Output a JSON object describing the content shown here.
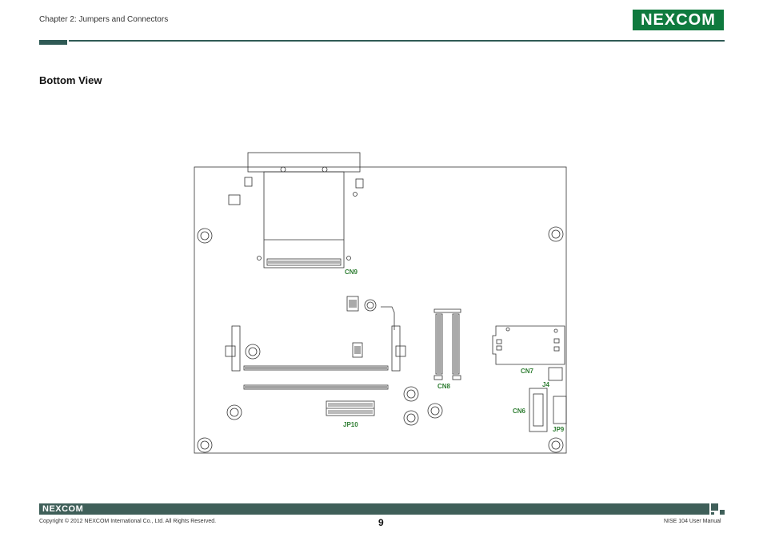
{
  "header": {
    "chapter": "Chapter 2: Jumpers and Connectors",
    "logo_text": "NEXCOM"
  },
  "section": {
    "title": "Bottom View"
  },
  "board": {
    "labels": {
      "cn9": "CN9",
      "cn8": "CN8",
      "cn7": "CN7",
      "cn6": "CN6",
      "j4": "J4",
      "jp9": "JP9",
      "jp10": "JP10"
    },
    "label_color": "#2e7d32"
  },
  "footer": {
    "logo_text": "NEXCOM",
    "copyright": "Copyright © 2012 NEXCOM International Co., Ltd. All Rights Reserved.",
    "page_number": "9",
    "manual": "NISE 104 User Manual",
    "bar_color": "#3f5f59"
  }
}
